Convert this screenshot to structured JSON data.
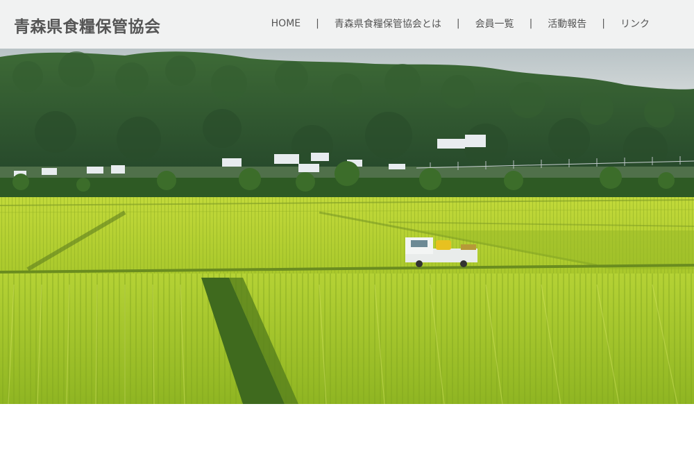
{
  "site": {
    "title": "青森県食糧保管協会"
  },
  "nav": {
    "items": [
      {
        "label": "HOME"
      },
      {
        "label": "青森県食糧保管協会とは"
      },
      {
        "label": "会員一覧"
      },
      {
        "label": "活動報告"
      },
      {
        "label": "リンク"
      }
    ],
    "separator": "|"
  },
  "colors": {
    "header_bg": "#f1f2f2",
    "text": "#555555",
    "sky": "#c9d2d6",
    "forest": "#2f5a2d",
    "field": "#a8c92a"
  },
  "hero": {
    "image_icon": "rice-field-landscape-photo"
  }
}
